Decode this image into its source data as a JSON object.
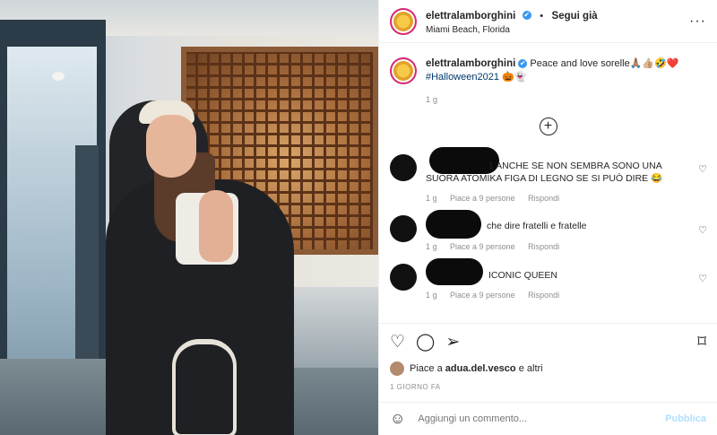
{
  "header": {
    "username": "elettralamborghini",
    "verified_mark": "✔",
    "separator": "•",
    "follow_label": "Segui già",
    "location": "Miami Beach, Florida",
    "more_icon": "···"
  },
  "caption": {
    "username": "elettralamborghini",
    "verified_mark": "✔",
    "text": "Peace and love sorelle🙏🏽👍🏼🤣❤️",
    "hashtag": "#Halloween2021",
    "emojis": "🎃👻",
    "time": "1 g"
  },
  "load_more_icon": "+",
  "comments": [
    {
      "text": "1 ANCHE SE NON SEMBRA SONO UNA SUORA ATOMIKA FIGA DI LEGNO SE SI PUÒ DIRE 😂",
      "time": "1 g",
      "likes": "Piace a 9 persone",
      "reply": "Rispondi"
    },
    {
      "text": "che dire fratelli e fratelle",
      "time": "1 g",
      "likes": "Piace a 9 persone",
      "reply": "Rispondi"
    },
    {
      "text": "ICONIC QUEEN",
      "time": "1 g",
      "likes": "Piace a 9 persone",
      "reply": "Rispondi"
    }
  ],
  "heart_icon": "♡",
  "actions": {
    "like_icon": "♡",
    "comment_icon": "◯",
    "share_icon": "➢",
    "save_icon": "⌑"
  },
  "likes": {
    "prefix": "Piace a",
    "user": "adua.del.vesco",
    "suffix": "e altri"
  },
  "date": "1 GIORNO FA",
  "add_comment": {
    "emoji_icon": "☺",
    "placeholder": "Aggiungi un commento...",
    "publish_label": "Pubblica"
  },
  "colors": {
    "link": "#00376b",
    "muted": "#8e8e8e",
    "publish_disabled": "#b2dffc",
    "verified": "#3897f0"
  }
}
